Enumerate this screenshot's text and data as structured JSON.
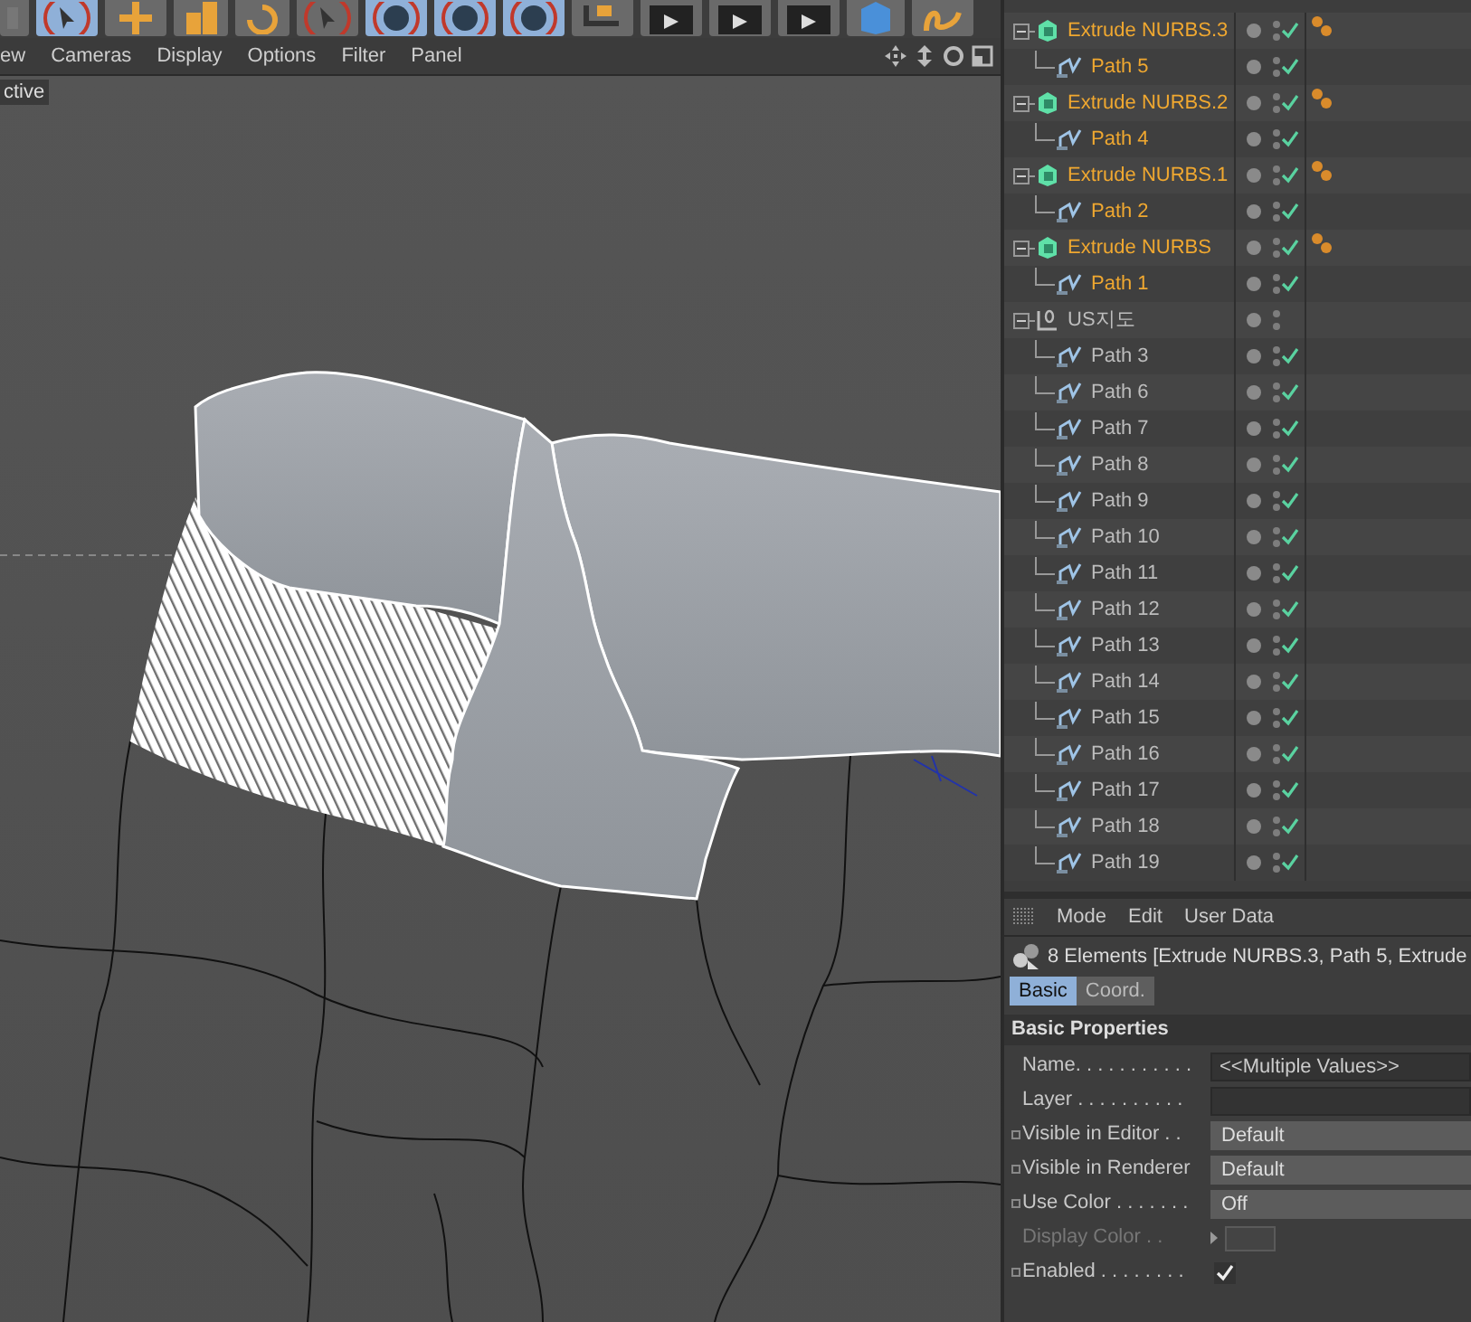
{
  "toolbar": [
    {
      "kind": "partial",
      "selected": false
    },
    {
      "kind": "select",
      "selected": true
    },
    {
      "kind": "move",
      "selected": false
    },
    {
      "kind": "scale",
      "selected": false
    },
    {
      "kind": "rotate",
      "selected": false
    },
    {
      "kind": "recent",
      "selected": false
    },
    {
      "kind": "x",
      "selected": true
    },
    {
      "kind": "y",
      "selected": true
    },
    {
      "kind": "z",
      "selected": true
    },
    {
      "kind": "coords",
      "selected": false
    },
    {
      "kind": "render",
      "selected": false
    },
    {
      "kind": "render",
      "selected": false
    },
    {
      "kind": "render",
      "selected": false
    },
    {
      "kind": "cube",
      "selected": false
    },
    {
      "kind": "pen",
      "selected": false
    }
  ],
  "viewport": {
    "menu": [
      "ew",
      "Cameras",
      "Display",
      "Options",
      "Filter",
      "Panel"
    ],
    "camera_label": "ctive"
  },
  "objects": [
    {
      "name": "Extrude NURBS.3",
      "kind": "extrude",
      "selected": true,
      "expanded": true,
      "enabled": true,
      "tagged": true,
      "children": [
        {
          "name": "Path 5",
          "kind": "path",
          "selected": true,
          "enabled": true,
          "tagged": false
        }
      ]
    },
    {
      "name": "Extrude NURBS.2",
      "kind": "extrude",
      "selected": true,
      "expanded": true,
      "enabled": true,
      "tagged": true,
      "children": [
        {
          "name": "Path 4",
          "kind": "path",
          "selected": true,
          "enabled": true,
          "tagged": false
        }
      ]
    },
    {
      "name": "Extrude NURBS.1",
      "kind": "extrude",
      "selected": true,
      "expanded": true,
      "enabled": true,
      "tagged": true,
      "children": [
        {
          "name": "Path 2",
          "kind": "path",
          "selected": true,
          "enabled": true,
          "tagged": false
        }
      ]
    },
    {
      "name": "Extrude NURBS",
      "kind": "extrude",
      "selected": true,
      "expanded": true,
      "enabled": true,
      "tagged": true,
      "children": [
        {
          "name": "Path 1",
          "kind": "path",
          "selected": true,
          "enabled": true,
          "tagged": false
        }
      ]
    },
    {
      "name": "US지도",
      "kind": "null",
      "selected": false,
      "expanded": true,
      "enabled": false,
      "tagged": false,
      "children": [
        {
          "name": "Path 3",
          "kind": "path",
          "selected": false,
          "enabled": true,
          "tagged": false
        },
        {
          "name": "Path 6",
          "kind": "path",
          "selected": false,
          "enabled": true,
          "tagged": false
        },
        {
          "name": "Path 7",
          "kind": "path",
          "selected": false,
          "enabled": true,
          "tagged": false
        },
        {
          "name": "Path 8",
          "kind": "path",
          "selected": false,
          "enabled": true,
          "tagged": false
        },
        {
          "name": "Path 9",
          "kind": "path",
          "selected": false,
          "enabled": true,
          "tagged": false
        },
        {
          "name": "Path 10",
          "kind": "path",
          "selected": false,
          "enabled": true,
          "tagged": false
        },
        {
          "name": "Path 11",
          "kind": "path",
          "selected": false,
          "enabled": true,
          "tagged": false
        },
        {
          "name": "Path 12",
          "kind": "path",
          "selected": false,
          "enabled": true,
          "tagged": false
        },
        {
          "name": "Path 13",
          "kind": "path",
          "selected": false,
          "enabled": true,
          "tagged": false
        },
        {
          "name": "Path 14",
          "kind": "path",
          "selected": false,
          "enabled": true,
          "tagged": false
        },
        {
          "name": "Path 15",
          "kind": "path",
          "selected": false,
          "enabled": true,
          "tagged": false
        },
        {
          "name": "Path 16",
          "kind": "path",
          "selected": false,
          "enabled": true,
          "tagged": false
        },
        {
          "name": "Path 17",
          "kind": "path",
          "selected": false,
          "enabled": true,
          "tagged": false
        },
        {
          "name": "Path 18",
          "kind": "path",
          "selected": false,
          "enabled": true,
          "tagged": false
        },
        {
          "name": "Path 19",
          "kind": "path",
          "selected": false,
          "enabled": true,
          "tagged": false
        }
      ]
    }
  ],
  "attributes": {
    "menu": [
      "Mode",
      "Edit",
      "User Data"
    ],
    "title": "8 Elements [Extrude NURBS.3, Path 5, Extrude",
    "tabs": [
      {
        "label": "Basic",
        "selected": true
      },
      {
        "label": "Coord.",
        "selected": false
      }
    ],
    "section": "Basic Properties",
    "fields": [
      {
        "kind": "text",
        "label": "Name. . . . . . . . . . .",
        "value": "<<Multiple Values>>",
        "animatable": false,
        "disabled": false
      },
      {
        "kind": "text",
        "label": "Layer . . . . . . . . . .",
        "animatable": false,
        "disabled": false
      },
      {
        "kind": "dropdown",
        "label": "Visible in Editor . .",
        "value": "Default",
        "animatable": true,
        "disabled": false
      },
      {
        "kind": "dropdown",
        "label": "Visible in Renderer",
        "value": "Default",
        "animatable": true,
        "disabled": false
      },
      {
        "kind": "dropdown",
        "label": "Use Color . . . . . . .",
        "value": "Off",
        "animatable": true,
        "disabled": false
      },
      {
        "kind": "color",
        "label": "Display Color . .",
        "animatable": false,
        "disabled": true
      },
      {
        "kind": "checkbox",
        "label": "Enabled . . . . . . . .",
        "checked": true,
        "animatable": true,
        "disabled": false
      }
    ]
  }
}
